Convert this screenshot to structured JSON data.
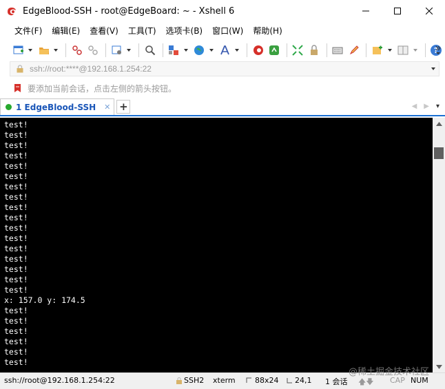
{
  "window": {
    "title": "EdgeBlood-SSH - root@EdgeBoard: ~ - Xshell 6",
    "app_icon": "xshell-logo-icon",
    "controls": [
      "minimize-icon",
      "maximize-icon",
      "close-icon"
    ]
  },
  "menubar": {
    "items": [
      {
        "label": "文件(F)"
      },
      {
        "label": "编辑(E)"
      },
      {
        "label": "查看(V)"
      },
      {
        "label": "工具(T)"
      },
      {
        "label": "选项卡(B)"
      },
      {
        "label": "窗口(W)"
      },
      {
        "label": "帮助(H)"
      }
    ]
  },
  "toolbar": {
    "icons": [
      "new-session-icon",
      "open-folder-icon",
      "connect-icon",
      "disconnect-icon",
      "properties-icon",
      "find-icon",
      "transfer-icon",
      "globe-icon",
      "font-icon",
      "xshell-icon",
      "xftp-icon",
      "fullscreen-icon",
      "lock-icon",
      "keyboard-icon",
      "pen-icon",
      "new-tab-icon",
      "layout-icon",
      "help-icon"
    ]
  },
  "address": {
    "value": "ssh://root:****@192.168.1.254:22"
  },
  "hint": {
    "text": "要添加当前会话，点击左侧的箭头按钮。"
  },
  "tabs": [
    {
      "label": "1 EdgeBlood-SSH",
      "status_color": "#27a92e",
      "active": true
    }
  ],
  "terminal": {
    "lines": [
      "test!",
      "test!",
      "test!",
      "test!",
      "test!",
      "test!",
      "test!",
      "test!",
      "test!",
      "test!",
      "test!",
      "test!",
      "test!",
      "test!",
      "test!",
      "test!",
      "test!",
      "x: 157.0 y: 174.5",
      "test!",
      "test!",
      "test!",
      "test!",
      "test!",
      "test!"
    ],
    "background": "#000000",
    "foreground": "#ffffff"
  },
  "statusbar": {
    "connection": "ssh://root@192.168.1.254:22",
    "protocol": "SSH2",
    "terminal_type": "xterm",
    "size": "88x24",
    "cursor": "24,1",
    "sessions": "1 会话",
    "caps": "CAP",
    "num": "NUM"
  },
  "watermark": "@稀土掘金技术社区"
}
